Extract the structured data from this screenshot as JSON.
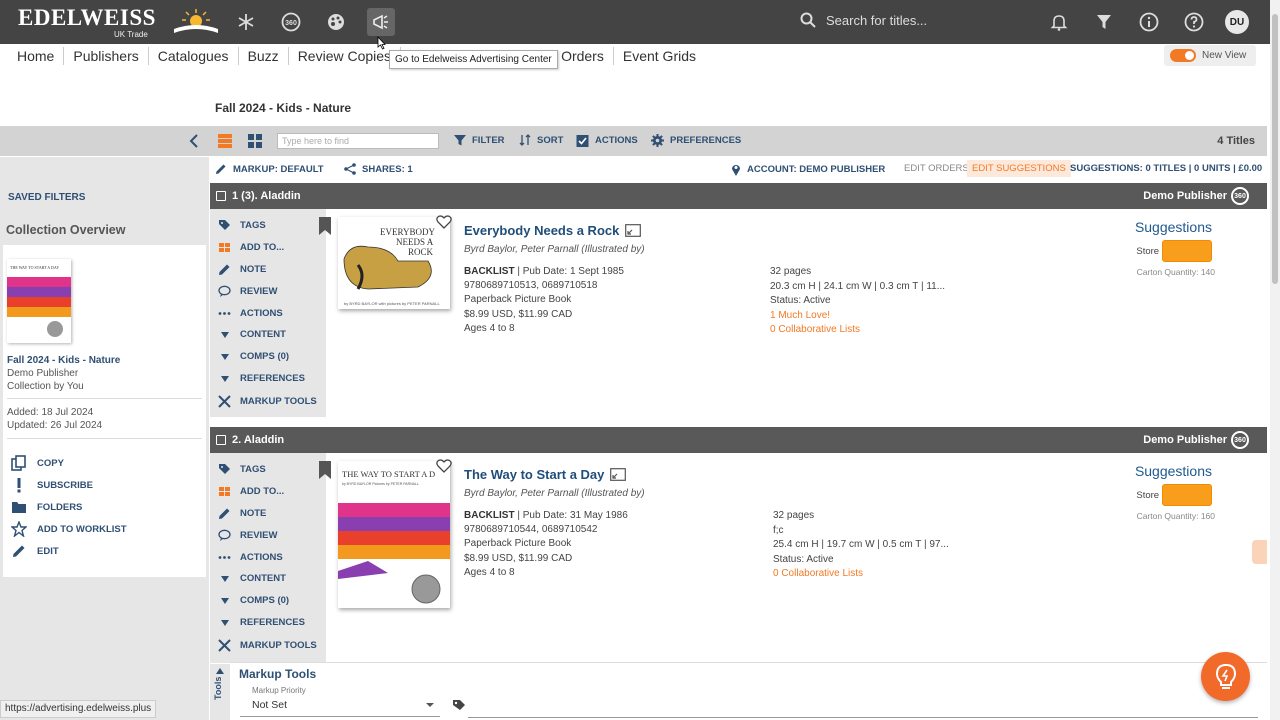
{
  "app": {
    "logo": "EDELWEISS",
    "logo_sub": "UK Trade",
    "search_placeholder": "Search for titles...",
    "user_initials": "DU",
    "icons": [
      "snowflake-icon",
      "360-icon",
      "palette-icon",
      "megaphone-icon"
    ],
    "badge_360": "360"
  },
  "nav": {
    "items": [
      "Home",
      "Publishers",
      "Catalogues",
      "Buzz",
      "Review Copies",
      "Orders",
      "Event Grids"
    ],
    "tooltip": "Go to Edelweiss Advertising Center",
    "new_view": "New View"
  },
  "page": {
    "title": "Fall 2024 - Kids - Nature"
  },
  "toolbar": {
    "find_placeholder": "Type here to find",
    "filter": "FILTER",
    "sort": "SORT",
    "actions": "ACTIONS",
    "preferences": "PREFERENCES",
    "titles_count": "4 Titles"
  },
  "markupbar": {
    "markup": "MARKUP: DEFAULT",
    "shares": "SHARES: 1",
    "account": "ACCOUNT: DEMO PUBLISHER",
    "edit_orders": "EDIT ORDERS",
    "edit_suggestions": "EDIT SUGGESTIONS",
    "summary": "SUGGESTIONS: 0 TITLES | 0 UNITS | £0.00"
  },
  "sidebar": {
    "saved_filters": "SAVED FILTERS",
    "collection_overview": "Collection Overview",
    "collection_name": "Fall 2024 - Kids - Nature",
    "publisher": "Demo Publisher",
    "collection_by": "Collection by You",
    "added": "Added: 18 Jul 2024",
    "updated": "Updated: 26 Jul 2024",
    "actions": [
      "COPY",
      "SUBSCRIBE",
      "FOLDERS",
      "ADD TO WORKLIST",
      "EDIT"
    ]
  },
  "row_actions": [
    "TAGS",
    "ADD TO...",
    "NOTE",
    "REVIEW",
    "ACTIONS",
    "CONTENT",
    "COMPS (0)",
    "REFERENCES",
    "MARKUP TOOLS"
  ],
  "groups": [
    {
      "header": "1 (3). Aladdin",
      "publisher": "Demo Publisher",
      "title": "Everybody Needs a Rock",
      "cover_title": "EVERYBODY NEEDS A ROCK",
      "cover_credit": "by BYRD BAYLOR  with pictures by PETER PARNALL",
      "authors": "Byrd Baylor, Peter Parnall (Illustrated by)",
      "status_label": "BACKLIST",
      "pub_date": " | Pub Date: 1 Sept 1985",
      "isbns": "9780689710513, 0689710518",
      "format": "Paperback Picture Book",
      "price": "$8.99 USD, $11.99 CAD",
      "ages": "Ages 4 to 8",
      "pages": "32 pages",
      "dims": "20.3 cm H | 24.1 cm W | 0.3 cm T | 11...",
      "fc": "",
      "status": "Status: Active",
      "love": "1 Much Love!",
      "collab": "0 Collaborative Lists",
      "suggestions": "Suggestions",
      "store": "Store 1",
      "carton": "Carton Quantity: 140"
    },
    {
      "header": "2. Aladdin",
      "publisher": "Demo Publisher",
      "title": "The Way to Start a Day",
      "cover_title": "THE WAY TO START A D",
      "cover_credit": "by BYRD BAYLOR  Pictures by PETER PARNALL",
      "authors": "Byrd Baylor, Peter Parnall (Illustrated by)",
      "status_label": "BACKLIST",
      "pub_date": " | Pub Date: 31 May 1986",
      "isbns": "9780689710544, 0689710542",
      "format": "Paperback Picture Book",
      "price": "$8.99 USD, $11.99 CAD",
      "ages": "Ages 4 to 8",
      "pages": "32 pages",
      "dims": "25.4 cm H | 19.7 cm W | 0.5 cm T | 97...",
      "fc": "f;c",
      "status": "Status: Active",
      "love": "",
      "collab": "0 Collaborative Lists",
      "suggestions": "Suggestions",
      "store": "Store 1",
      "carton": "Carton Quantity: 160"
    }
  ],
  "markup_tools": {
    "tab_label": "Tools",
    "title": "Markup Tools",
    "priority_label": "Markup Priority",
    "priority_value": "Not Set"
  },
  "status_url": "https://advertising.edelweiss.plus",
  "colors": {
    "accent": "#f27a24",
    "link": "#2f4f73",
    "title": "#1f4e79",
    "header": "#444444"
  }
}
